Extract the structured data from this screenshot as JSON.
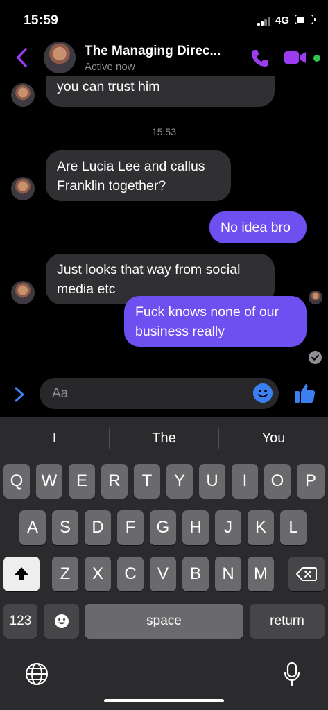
{
  "status_bar": {
    "time": "15:59",
    "network": "4G",
    "battery_level": 0.55
  },
  "header": {
    "contact_name": "The Managing Direc...",
    "status": "Active now",
    "icons": [
      "chevron-left-icon",
      "phone-icon",
      "video-icon"
    ],
    "accent_color": "#9b3cf0",
    "online_color": "#31c451"
  },
  "messages": [
    {
      "direction": "in",
      "lines": [
        "you can trust him"
      ]
    },
    {
      "type": "timestamp",
      "text": "15:53"
    },
    {
      "direction": "in",
      "lines": [
        "Are Lucia Lee and callus",
        "Franklin together?"
      ]
    },
    {
      "direction": "out",
      "lines": [
        "No idea bro"
      ]
    },
    {
      "direction": "in",
      "lines": [
        "Just looks that way from social",
        "media etc"
      ]
    },
    {
      "direction": "out",
      "lines": [
        "Fuck knows none of our",
        "business really"
      ]
    }
  ],
  "composer": {
    "placeholder": "Aa",
    "icons": [
      "chevron-right-icon",
      "smiley-icon",
      "thumbs-up-icon"
    ]
  },
  "keyboard": {
    "suggestions": [
      "I",
      "The",
      "You"
    ],
    "row1": [
      "Q",
      "W",
      "E",
      "R",
      "T",
      "Y",
      "U",
      "I",
      "O",
      "P"
    ],
    "row2": [
      "A",
      "S",
      "D",
      "F",
      "G",
      "H",
      "J",
      "K",
      "L"
    ],
    "row3": [
      "Z",
      "X",
      "C",
      "V",
      "B",
      "N",
      "M"
    ],
    "numbers_label": "123",
    "space_label": "space",
    "return_label": "return",
    "icons": [
      "shift-icon",
      "backspace-icon",
      "emoji-icon",
      "globe-icon",
      "microphone-icon"
    ]
  },
  "colors": {
    "outgoing_bubble": "#6e4ff0",
    "incoming_bubble": "#303033",
    "keyboard_bg": "#2b2b2d"
  }
}
